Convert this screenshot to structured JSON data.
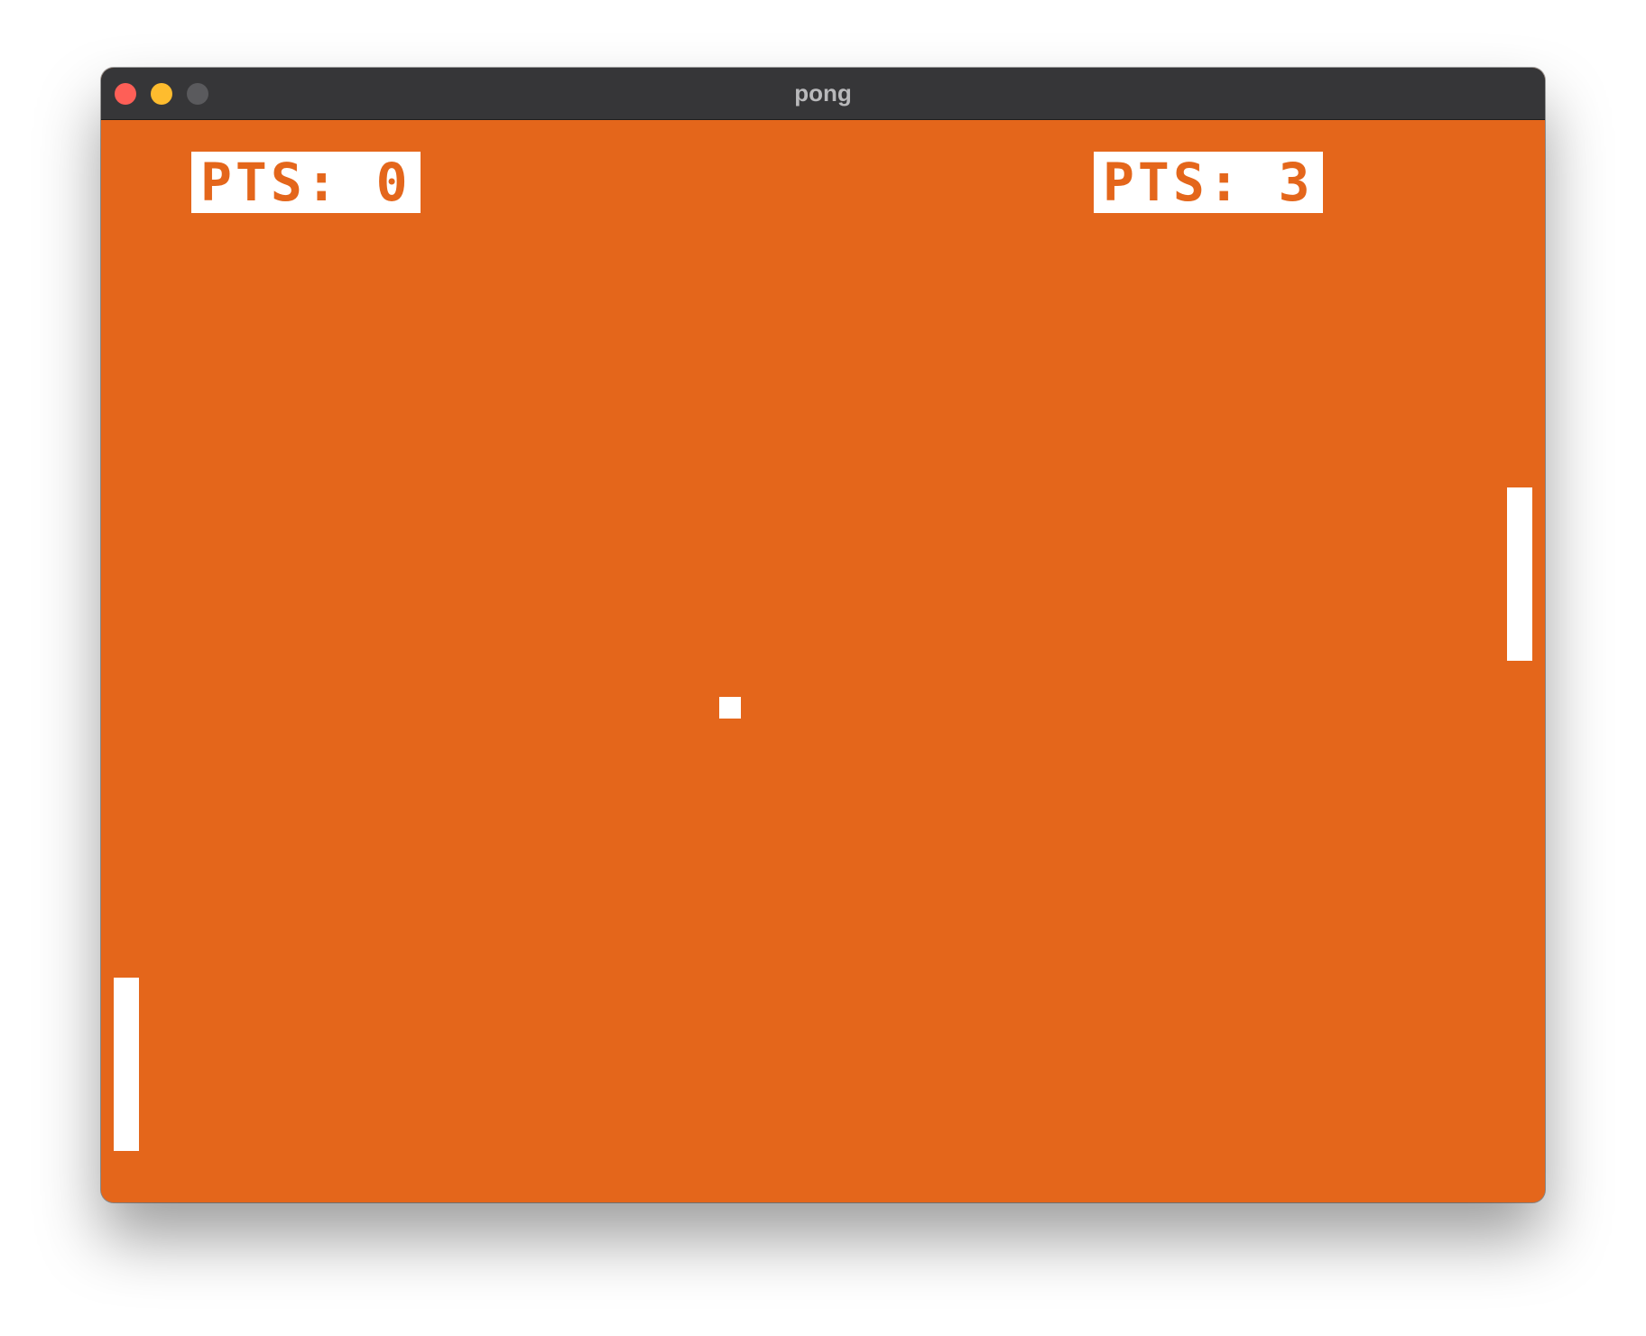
{
  "window": {
    "title": "pong"
  },
  "scores": {
    "left": {
      "text": "PTS: 0",
      "value": 0
    },
    "right": {
      "text": "PTS: 3",
      "value": 3
    }
  },
  "colors": {
    "court": "#e4661b",
    "foreground": "#ffffff",
    "titlebar": "#363638",
    "close": "#fe5f57",
    "minimize": "#febc2e",
    "zoom": "#5a5a5d"
  }
}
